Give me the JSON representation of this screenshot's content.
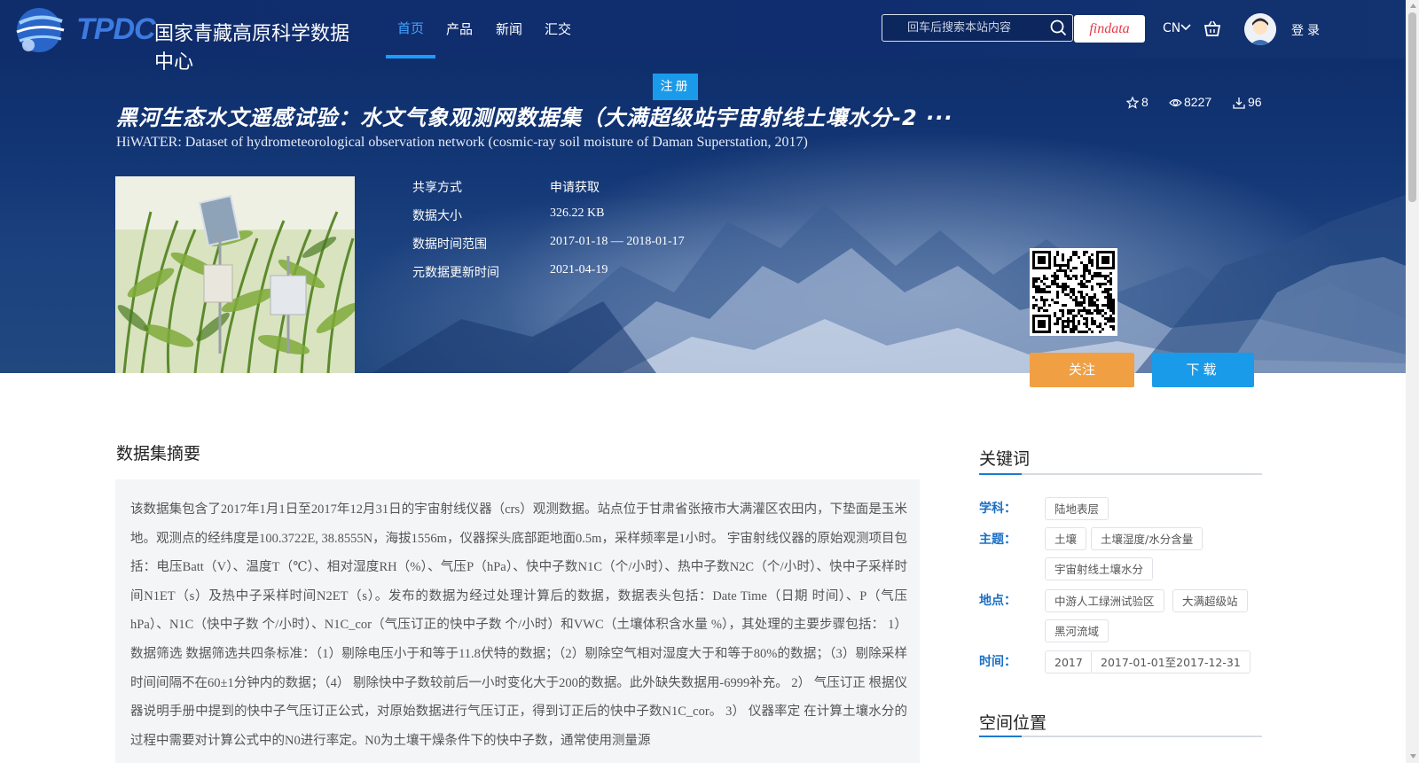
{
  "header": {
    "logo_text": "TPDC",
    "logo_cn": "国家青藏高原科学数据中心",
    "nav": [
      "首页",
      "产品",
      "新闻",
      "汇交"
    ],
    "search_placeholder": "回车后搜索本站内容",
    "findata_label": "findata",
    "lang": "CN",
    "login": "登录"
  },
  "register_label": "注册",
  "dataset": {
    "title_cn": "黑河生态水文遥感试验：水文气象观测网数据集（大满超级站宇宙射线土壤水分-2 ···",
    "title_en": "HiWATER: Dataset of hydrometeorological observation network (cosmic-ray soil moisture of Daman Superstation, 2017)",
    "stats": {
      "stars": "8",
      "views": "8227",
      "downloads": "96"
    },
    "meta": [
      {
        "label": "共享方式",
        "value": "申请获取"
      },
      {
        "label": "数据大小",
        "value": "326.22 KB"
      },
      {
        "label": "数据时间范围",
        "value": "2017-01-18 — 2018-01-17"
      },
      {
        "label": "元数据更新时间",
        "value": "2021-04-19"
      }
    ],
    "follow_label": "关注",
    "download_label": "下载"
  },
  "abstract": {
    "heading": "数据集摘要",
    "text": "该数据集包含了2017年1月1日至2017年12月31日的宇宙射线仪器（crs）观测数据。站点位于甘肃省张掖市大满灌区农田内，下垫面是玉米地。观测点的经纬度是100.3722E, 38.8555N，海拔1556m，仪器探头底部距地面0.5m，采样频率是1小时。 宇宙射线仪器的原始观测项目包括：电压Batt（V）、温度T（℃）、相对湿度RH（%）、气压P（hPa）、快中子数N1C（个/小时）、热中子数N2C（个/小时）、快中子采样时间N1ET（s）及热中子采样时间N2ET（s）。发布的数据为经过处理计算后的数据，数据表头包括：Date Time（日期 时间）、P（气压 hPa）、N1C（快中子数 个/小时）、N1C_cor（气压订正的快中子数 个/小时）和VWC（土壤体积含水量 %），其处理的主要步骤包括： 1） 数据筛选 数据筛选共四条标准：（1）剔除电压小于和等于11.8伏特的数据；（2）剔除空气相对湿度大于和等于80%的数据；（3）剔除采样时间间隔不在60±1分钟内的数据；（4） 剔除快中子数较前后一小时变化大于200的数据。此外缺失数据用-6999补充。 2） 气压订正 根据仪器说明手册中提到的快中子气压订正公式，对原始数据进行气压订正，得到订正后的快中子数N1C_cor。 3） 仪器率定 在计算土壤水分的过程中需要对计算公式中的N0进行率定。N0为土壤干燥条件下的快中子数，通常使用测量源"
  },
  "keywords": {
    "heading": "关键词",
    "groups": [
      {
        "label": "学科：",
        "tags": [
          "陆地表层"
        ]
      },
      {
        "label": "主题：",
        "tags": [
          "土壤",
          "土壤湿度/水分含量",
          "宇宙射线土壤水分"
        ]
      },
      {
        "label": "地点：",
        "tags": [
          "中游人工绿洲试验区",
          "大满超级站",
          "黑河流域"
        ]
      },
      {
        "label": "时间：",
        "tags": [
          "2017",
          "2017-01-01至2017-12-31"
        ]
      }
    ]
  },
  "spatial": {
    "heading": "空间位置"
  },
  "colors": {
    "accent": "#1a9bea",
    "follow": "#f0a043",
    "keyword_label": "#1a6fc4",
    "hero": "#123574"
  }
}
